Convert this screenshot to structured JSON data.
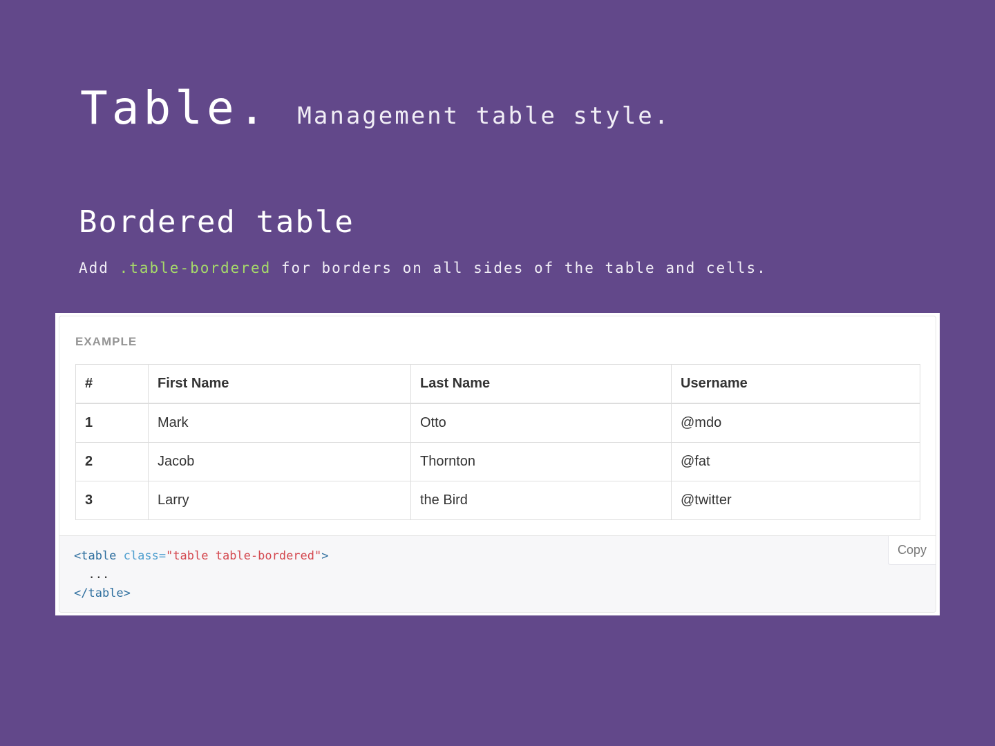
{
  "header": {
    "title": "Table.",
    "subtitle": "Management table style."
  },
  "section": {
    "title": "Bordered table",
    "desc_prefix": "Add",
    "desc_code": ".table-bordered",
    "desc_suffix": "for borders on all sides of the table and cells."
  },
  "example": {
    "label": "EXAMPLE",
    "columns": [
      "#",
      "First Name",
      "Last Name",
      "Username"
    ],
    "rows": [
      [
        "1",
        "Mark",
        "Otto",
        "@mdo"
      ],
      [
        "2",
        "Jacob",
        "Thornton",
        "@fat"
      ],
      [
        "3",
        "Larry",
        "the Bird",
        "@twitter"
      ]
    ],
    "code": {
      "open_tag": "<table",
      "attr": " class=",
      "value": "\"table table-bordered\"",
      "close_bracket": ">",
      "ellipsis": "  ...",
      "end_tag": "</table>"
    },
    "copy_label": "Copy"
  }
}
